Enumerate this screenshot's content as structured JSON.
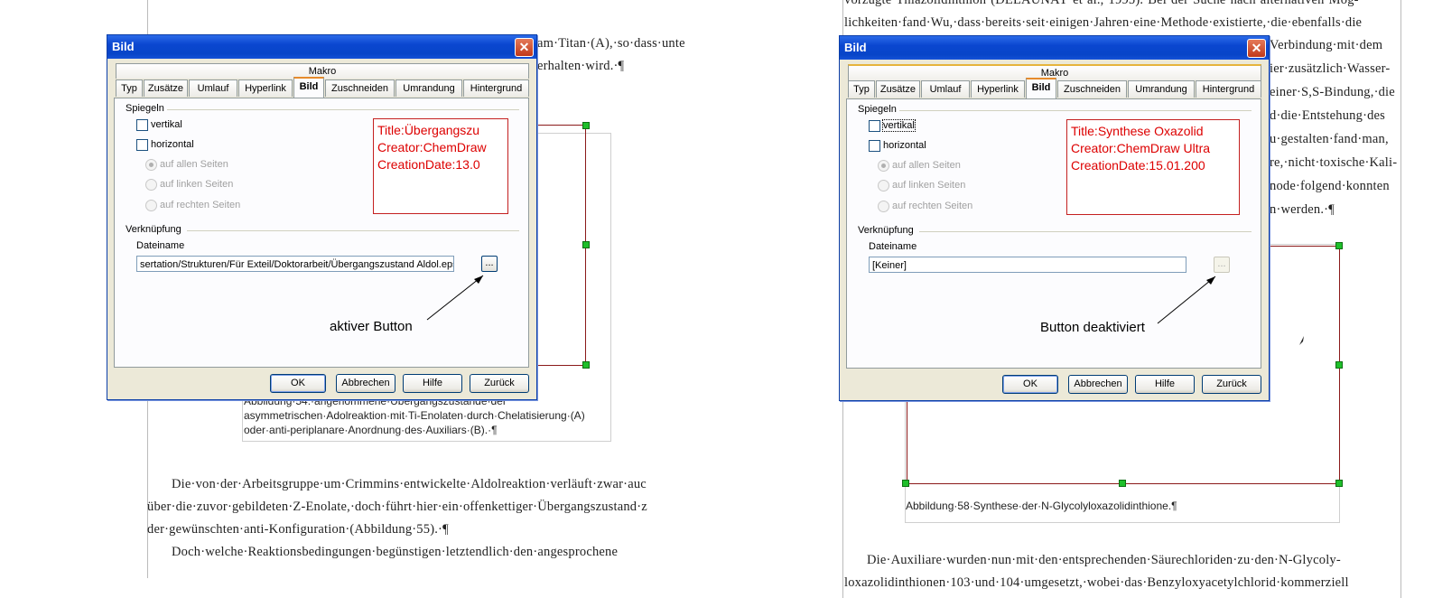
{
  "left": {
    "doc_top_lines": [
      "am·Titan·(A),·so·dass·unte",
      "erhalten·wird.·¶"
    ],
    "caption_lines": [
      "Abbildung·54:·angenommene·Übergangszustände·der",
      "asymmetrischen·Adolreaktion·mit·Ti-Enolaten·durch·Chelatisierung·(A)",
      "oder·anti-periplanare·Anordnung·des·Auxiliars·(B).·¶"
    ],
    "body_lines": [
      "Die·von·der·Arbeitsgruppe·um·Crimmins·entwickelte·Aldolreaktion·verläuft·zwar·auc",
      "über·die·zuvor·gebildeten·Z-Enolate,·doch·führt·hier·ein·offenkettiger·Übergangszustand·z",
      "der·gewünschten·anti-Konfiguration·(Abbildung·55).·¶",
      "Doch·welche·Reaktionsbedingungen·begünstigen·letztendlich·den·angesprochene"
    ],
    "dialog": {
      "title": "Bild",
      "macro_tab": "Makro",
      "tabs": [
        "Typ",
        "Zusätze",
        "Umlauf",
        "Hyperlink",
        "Bild",
        "Zuschneiden",
        "Umrandung",
        "Hintergrund"
      ],
      "section_mirror": "Spiegeln",
      "cb_vertical": "vertikal",
      "cb_horizontal": "horizontal",
      "radio_all": "auf allen Seiten",
      "radio_left": "auf linken Seiten",
      "radio_right": "auf rechten Seiten",
      "section_link": "Verknüpfung",
      "filename_label": "Dateiname",
      "filename_value": "sertation/Strukturen/Für Exteil/Doktorarbeit/Übergangszustand Aldol.eps",
      "browse_label": "...",
      "preview_lines": [
        "Title:Übergangszu",
        "Creator:ChemDraw",
        "CreationDate:13.0"
      ],
      "annotation": "aktiver Button",
      "btn_ok": "OK",
      "btn_cancel": "Abbrechen",
      "btn_help": "Hilfe",
      "btn_back": "Zurück"
    }
  },
  "right": {
    "doc_top_lines": [
      "vorzügte·Thiazolidinthion·(DELAUNAY·et·al.,·1995).·Bei·der·Suche·nach·alternativen·Mög-",
      "lichkeiten·fand·Wu,·dass·bereits·seit·einigen·Jahren·eine·Methode·existierte,·die·ebenfalls·die"
    ],
    "doc_side_lines": [
      "Verbindung·mit·dem",
      "ier·zusätzlich·Wasser-",
      "einer·S,S-Bindung,·die",
      "d·die·Entstehung·des",
      "u·gestalten·fand·man,",
      "re,·nicht·toxische·Kali-",
      "node·folgend·konnten",
      "n·werden.·¶"
    ],
    "caption": "Abbildung·58·Synthese·der·N-Glycolyloxazolidinthione.¶",
    "body_lines": [
      "Die·Auxiliare·wurden·nun·mit·den·entsprechenden·Säurechloriden·zu·den·N-Glycoly-",
      "loxazolidinthionen·103·und·104·umgesetzt,·wobei·das·Benzyloxyacetylchlorid·kommerziell"
    ],
    "dialog": {
      "title": "Bild",
      "macro_tab": "Makro",
      "tabs": [
        "Typ",
        "Zusätze",
        "Umlauf",
        "Hyperlink",
        "Bild",
        "Zuschneiden",
        "Umrandung",
        "Hintergrund"
      ],
      "section_mirror": "Spiegeln",
      "cb_vertical": "vertikal",
      "cb_horizontal": "horizontal",
      "radio_all": "auf allen Seiten",
      "radio_left": "auf linken Seiten",
      "radio_right": "auf rechten Seiten",
      "section_link": "Verknüpfung",
      "filename_label": "Dateiname",
      "filename_value": "[Keiner]",
      "browse_label": "...",
      "preview_lines": [
        "Title:Synthese Oxazolid",
        "Creator:ChemDraw Ultra",
        "CreationDate:15.01.200"
      ],
      "annotation": "Button deaktiviert",
      "btn_ok": "OK",
      "btn_cancel": "Abbrechen",
      "btn_help": "Hilfe",
      "btn_back": "Zurück"
    }
  }
}
